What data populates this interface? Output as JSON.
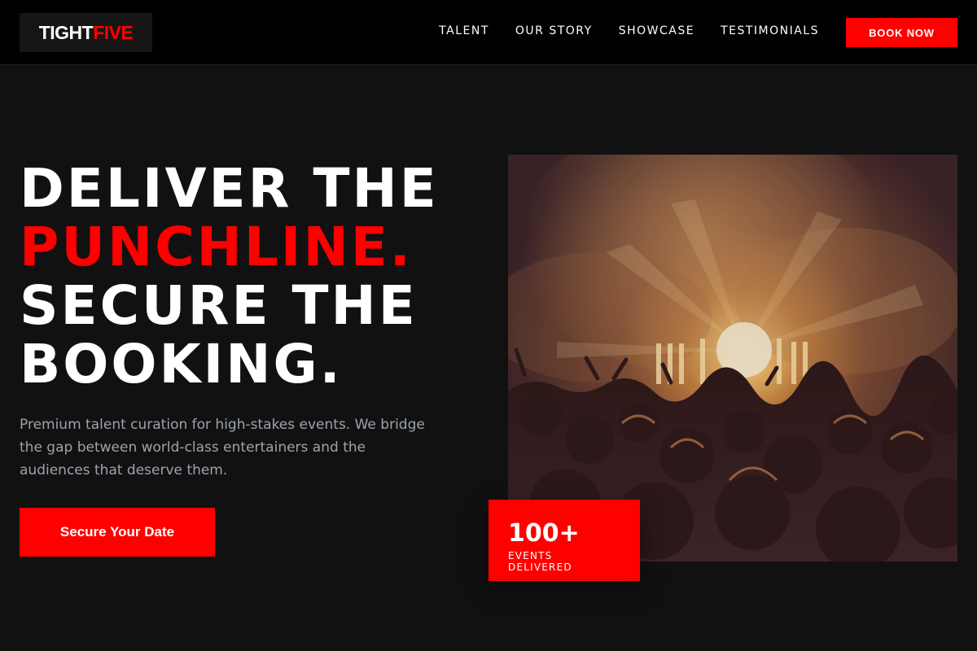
{
  "brand": {
    "logo_part1": "TIGHT",
    "logo_part2": "FIVE"
  },
  "nav": {
    "items": [
      {
        "label": "TALENT"
      },
      {
        "label": "OUR STORY"
      },
      {
        "label": "SHOWCASE"
      },
      {
        "label": "TESTIMONIALS"
      }
    ],
    "cta_label": "BOOK NOW"
  },
  "hero": {
    "line1": "DELIVER THE",
    "line2": "PUNCHLINE.",
    "line3": "SECURE THE",
    "line4": "BOOKING.",
    "description": "Premium talent curation for high-stakes events. We bridge the gap between world-class entertainers and the audiences that deserve them.",
    "cta_label": "Secure Your Date"
  },
  "stat": {
    "value": "100+",
    "label": "EVENTS DELIVERED"
  },
  "colors": {
    "accent": "#ff0000",
    "background": "#111111",
    "header": "#000000",
    "muted_text": "#9ca3af"
  }
}
